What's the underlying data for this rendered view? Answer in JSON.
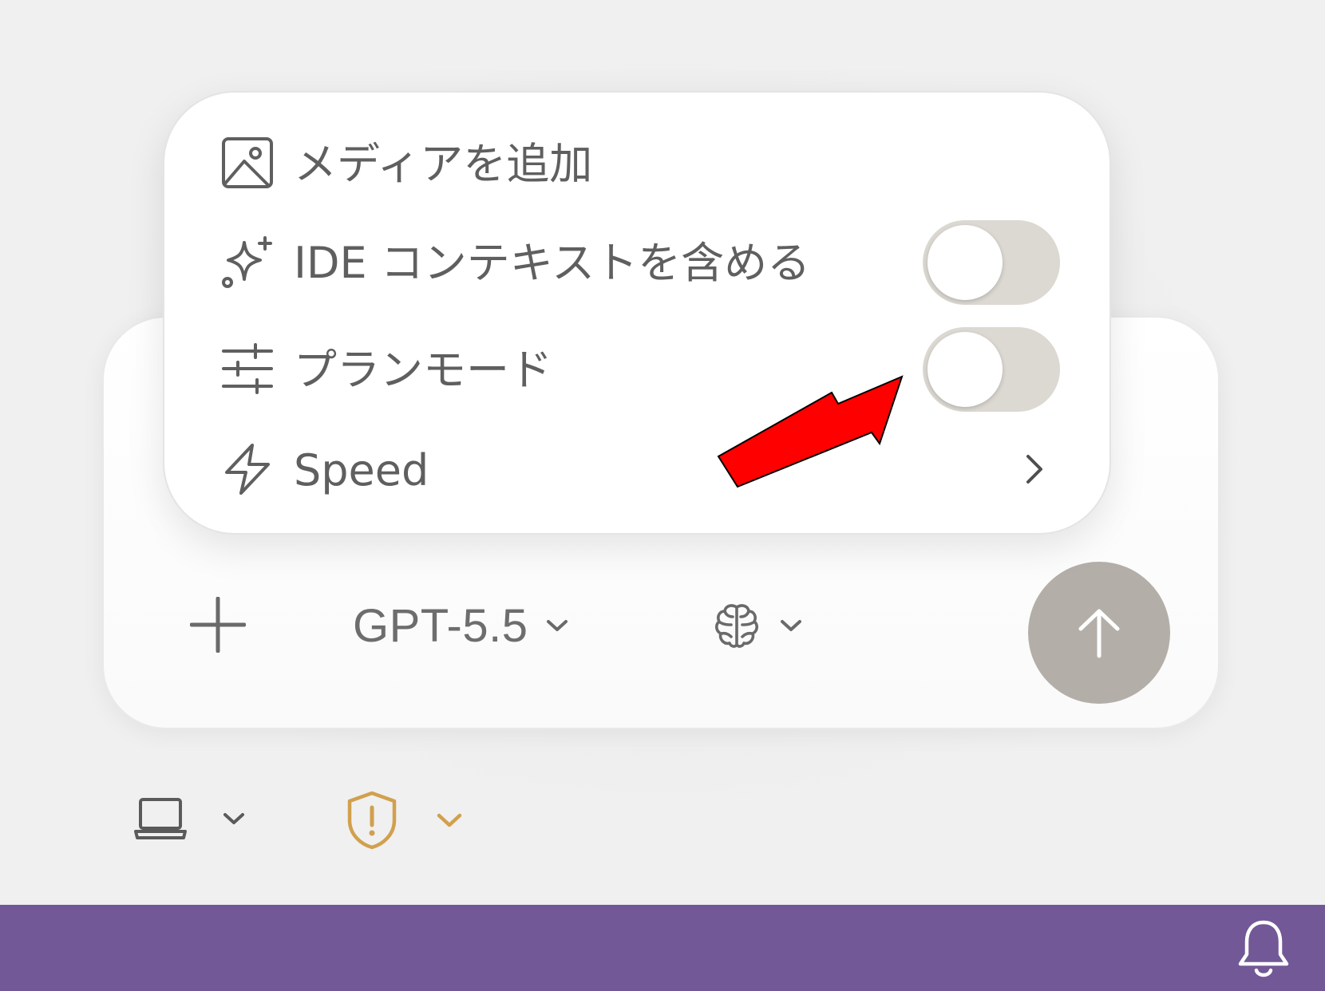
{
  "menu": {
    "items": [
      {
        "label": "メディアを追加",
        "icon": "image-icon"
      },
      {
        "label": "IDE コンテキストを含める",
        "icon": "sparkle-plus-icon",
        "toggle": false
      },
      {
        "label": "プランモード",
        "icon": "sliders-icon",
        "toggle": false
      },
      {
        "label": "Speed",
        "icon": "lightning-icon",
        "submenu": true
      }
    ]
  },
  "composer": {
    "model": "GPT-5.5",
    "reasoning_icon": "brain-icon",
    "send_icon": "arrow-up-icon"
  },
  "footer": {
    "environment_icon": "laptop-icon",
    "permissions_icon": "shield-warning-icon"
  },
  "status_bar": {
    "color": "#725897",
    "notification_icon": "bell-icon"
  },
  "colors": {
    "send_button": "#b3aea8",
    "toggle_off": "#dcd8d2",
    "shield_accent": "#d1a04e",
    "annotation_arrow": "#ff0000"
  }
}
